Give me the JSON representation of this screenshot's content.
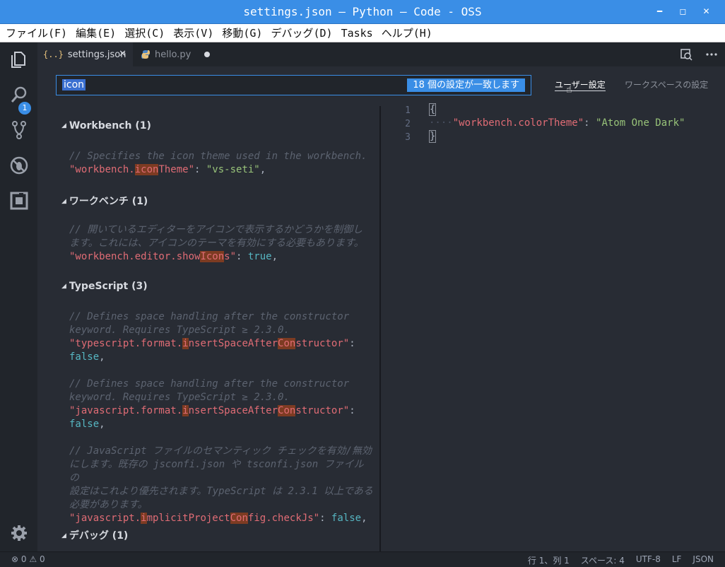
{
  "window": {
    "title": "settings.json — Python — Code - OSS"
  },
  "menu": [
    "ファイル(F)",
    "編集(E)",
    "選択(C)",
    "表示(V)",
    "移動(G)",
    "デバッグ(D)",
    "Tasks",
    "ヘルプ(H)"
  ],
  "activity": {
    "explorer_badge": "1"
  },
  "tabs": [
    {
      "icon": "{..}",
      "label": "settings.json",
      "active": true,
      "close": "✕"
    },
    {
      "icon": "python-icon",
      "label": "hello.py",
      "active": false,
      "dirty": true
    }
  ],
  "search": {
    "query": "icon",
    "count_label": "18 個の設定が一致します"
  },
  "scopes": {
    "user": "ユーザー設定",
    "workspace": "ワークスペースの設定"
  },
  "sections": [
    {
      "title": "Workbench (1)"
    },
    {
      "title": "ワークベンチ (1)"
    },
    {
      "title": "TypeScript (3)"
    },
    {
      "title": "デバッグ (1)"
    }
  ],
  "settings": {
    "s1": {
      "comment": "// Specifies the icon theme used in the workbench.",
      "key_pre": "\"workbench.",
      "key_hl": "icon",
      "key_post": "Theme\"",
      "value": "\"vs-seti\""
    },
    "s2": {
      "comment1": "// 開いているエディターをアイコンで表示するかどうかを制御し",
      "comment2": "ます。これには、アイコンのテーマを有効にする必要もあります。",
      "key_pre": "\"workbench.editor.show",
      "key_hl": "Icon",
      "key_post": "s\"",
      "value": "true"
    },
    "s3": {
      "comment1": "// Defines space handling after the constructor",
      "comment2": "keyword. Requires TypeScript ≥ 2.3.0.",
      "key_pre": "\"typescript.format.",
      "key_hl1": "i",
      "key_mid": "nsertSpaceAfter",
      "key_hl2": "Con",
      "key_post": "structor\"",
      "value": "false"
    },
    "s4": {
      "comment1": "// Defines space handling after the constructor",
      "comment2": "keyword. Requires TypeScript ≥ 2.3.0.",
      "key_pre": "\"javascript.format.",
      "key_hl1": "i",
      "key_mid": "nsertSpaceAfter",
      "key_hl2": "Con",
      "key_post": "structor\"",
      "value": "false"
    },
    "s5": {
      "comment1": "// JavaScript ファイルのセマンティック チェックを有効/無効",
      "comment2": "にします。既存の jsconfi.json や tsconfi.json ファイルの",
      "comment3": "設定はこれより優先されます。TypeScript は 2.3.1 以上である",
      "comment4": "必要があります。",
      "key_pre": "\"javascript.",
      "key_hl1": "i",
      "key_mid": "mplicitProject",
      "key_hl2": "Con",
      "key_post": "fig.checkJs\"",
      "value": "false"
    }
  },
  "user_settings": {
    "lines": [
      "1",
      "2",
      "3"
    ],
    "open_brace": "{",
    "close_brace": "}",
    "key": "\"workbench.colorTheme\"",
    "value": "\"Atom One Dark\""
  },
  "status": {
    "errors": "0",
    "warnings": "0",
    "position": "行 1、列 1",
    "spaces": "スペース: 4",
    "encoding": "UTF-8",
    "eol": "LF",
    "language": "JSON"
  }
}
